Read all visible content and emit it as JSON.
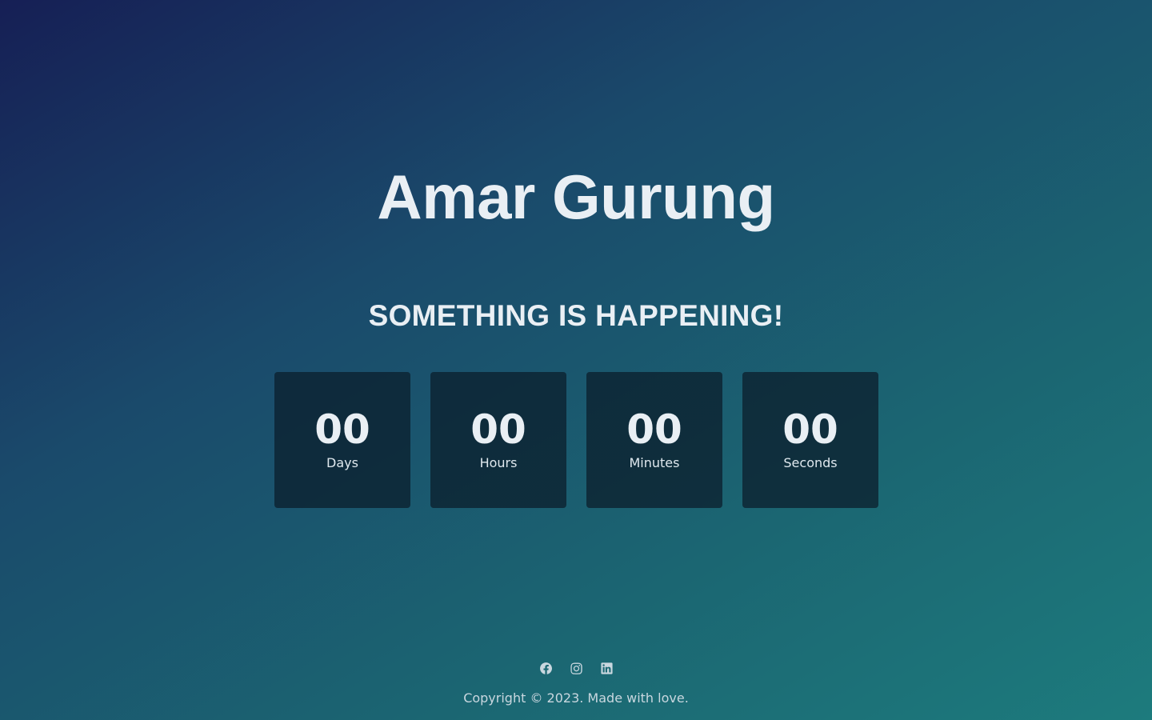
{
  "hero": {
    "name": "Amar Gurung",
    "headline": "SOMETHING IS HAPPENING!"
  },
  "countdown": [
    {
      "value": "00",
      "label": "Days"
    },
    {
      "value": "00",
      "label": "Hours"
    },
    {
      "value": "00",
      "label": "Minutes"
    },
    {
      "value": "00",
      "label": "Seconds"
    }
  ],
  "footer": {
    "social": [
      {
        "icon": "facebook-icon"
      },
      {
        "icon": "instagram-icon"
      },
      {
        "icon": "linkedin-icon"
      }
    ],
    "copyright": "Copyright © 2023. Made with love."
  },
  "colors": {
    "gradient_start": "#161f55",
    "gradient_end": "#1d7b7d",
    "box_background": "#0c202e",
    "text": "#e9eff4"
  }
}
